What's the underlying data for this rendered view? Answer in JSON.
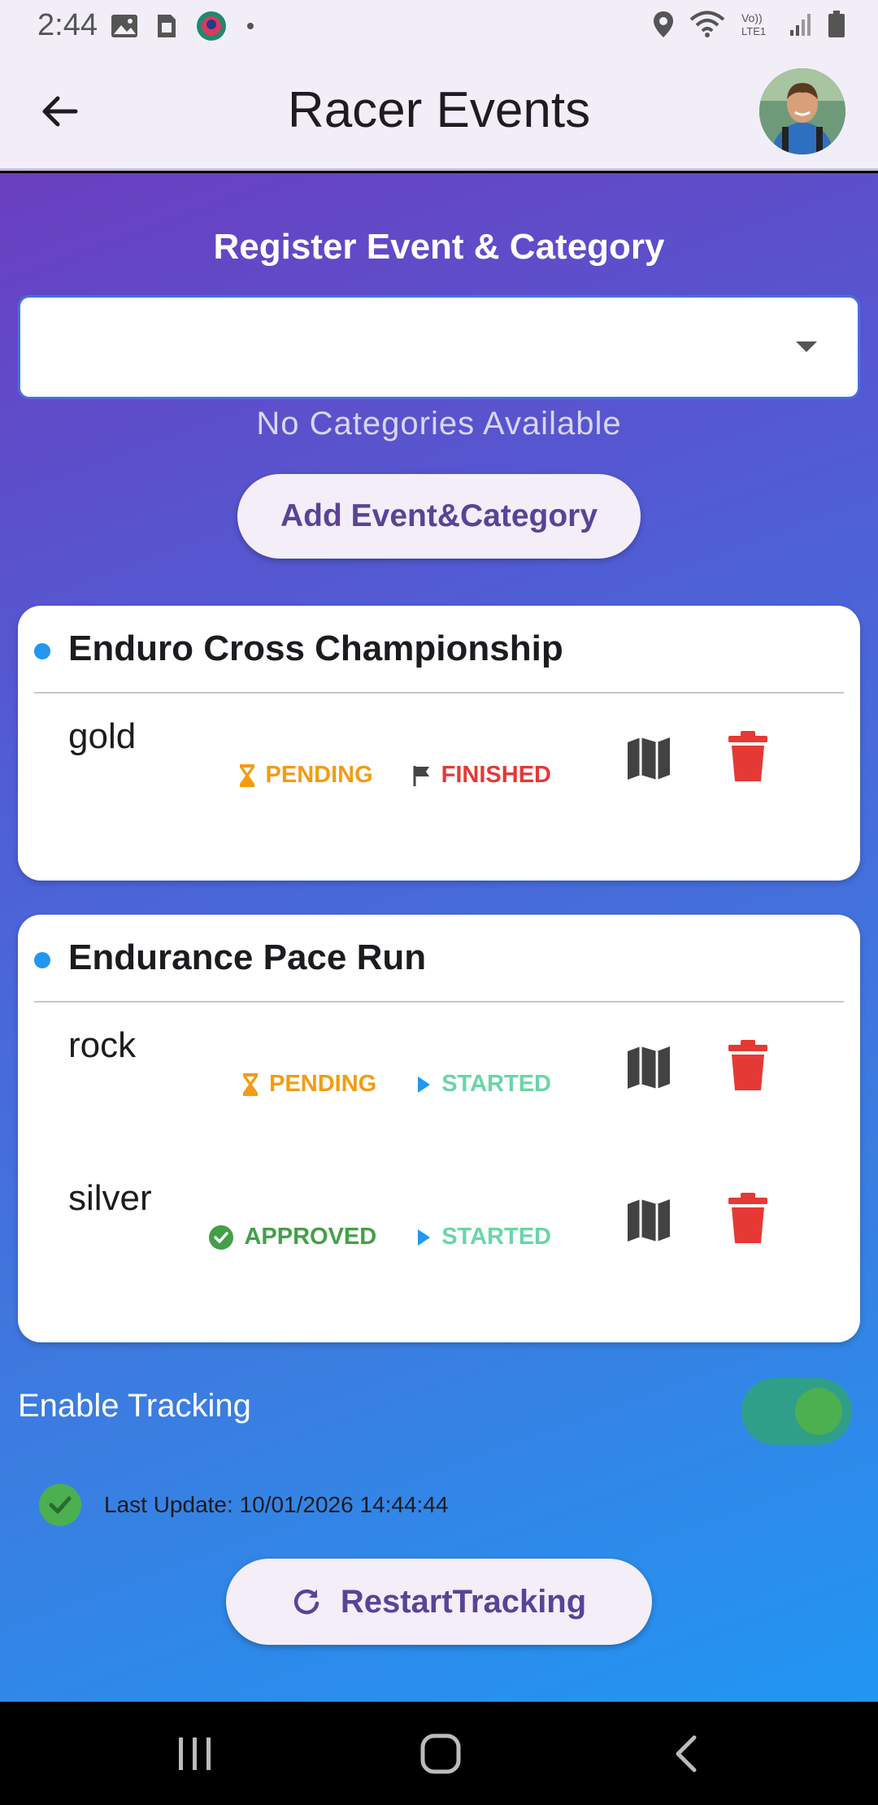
{
  "status_bar": {
    "time": "2:44"
  },
  "app_bar": {
    "title": "Racer Events"
  },
  "register": {
    "title": "Register Event & Category",
    "no_categories": "No Categories Available",
    "add_button": "Add Event&Category"
  },
  "events": [
    {
      "title": "Enduro Cross Championship",
      "categories": [
        {
          "name": "gold",
          "approval": "PENDING",
          "race_status": "FINISHED"
        }
      ]
    },
    {
      "title": "Endurance Pace Run",
      "categories": [
        {
          "name": "rock",
          "approval": "PENDING",
          "race_status": "STARTED"
        },
        {
          "name": "silver",
          "approval": "APPROVED",
          "race_status": "STARTED"
        }
      ]
    }
  ],
  "tracking": {
    "label": "Enable Tracking",
    "enabled": true,
    "last_update": "Last Update: 10/01/2026 14:44:44",
    "restart_button": "RestartTracking"
  },
  "colors": {
    "pending": "#f39c12",
    "approved": "#43a047",
    "finished": "#e53935",
    "started": "#69d6a5",
    "accent": "#5a4396"
  }
}
